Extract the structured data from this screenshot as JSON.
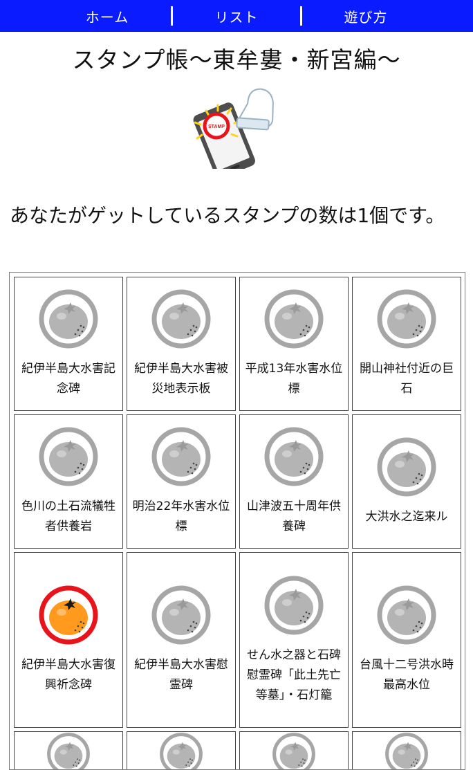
{
  "nav": {
    "home": "ホーム",
    "list": "リスト",
    "howto": "遊び方"
  },
  "page_title": "スタンプ帳〜東牟婁・新宮編〜",
  "hero": {
    "stamp_text": "STAMP"
  },
  "summary": {
    "prefix": "あなたがゲットしているスタンプの数は",
    "count": "1",
    "suffix": "個です。"
  },
  "stamps": [
    {
      "name": "紀伊半島大水害記念碑",
      "collected": false
    },
    {
      "name": "紀伊半島大水害被災地表示板",
      "collected": false
    },
    {
      "name": "平成13年水害水位標",
      "collected": false
    },
    {
      "name": "開山神社付近の巨石",
      "collected": false
    },
    {
      "name": "色川の土石流犠牲者供養岩",
      "collected": false
    },
    {
      "name": "明治22年水害水位標",
      "collected": false
    },
    {
      "name": "山津波五十周年供養碑",
      "collected": false
    },
    {
      "name": "大洪水之迄来ル",
      "collected": false
    },
    {
      "name": "紀伊半島大水害復興祈念碑",
      "collected": true
    },
    {
      "name": "紀伊半島大水害慰霊碑",
      "collected": false
    },
    {
      "name": "せん水之器と石碑慰霊碑「此土先亡等墓」・石灯籠",
      "collected": false
    },
    {
      "name": "台風十二号洪水時最高水位",
      "collected": false
    },
    {
      "name": "",
      "collected": false
    },
    {
      "name": "",
      "collected": false
    },
    {
      "name": "",
      "collected": false
    },
    {
      "name": "",
      "collected": false
    }
  ],
  "colors": {
    "nav_bg": "#0a1bff",
    "collected_ring": "#e8141c",
    "collected_fruit": "#ff9a1e",
    "uncollected_ring": "#a6a6a6",
    "uncollected_fruit": "#b4b4b4"
  }
}
